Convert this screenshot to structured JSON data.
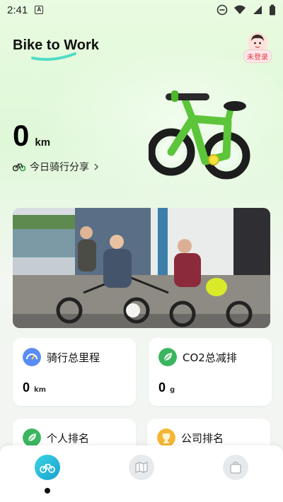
{
  "status_bar": {
    "time": "2:41",
    "badge": "A"
  },
  "header": {
    "title": "Bike to Work",
    "login_badge": "未登录"
  },
  "today": {
    "distance_value": "0",
    "distance_unit": "km",
    "share_label": "今日骑行分享"
  },
  "stats": [
    {
      "title": "骑行总里程",
      "value": "0",
      "unit": "km",
      "icon": "speedometer-icon",
      "color": "#5b8cf5"
    },
    {
      "title": "CO2总减排",
      "value": "0",
      "unit": "g",
      "icon": "leaf-icon",
      "color": "#3bb55f"
    },
    {
      "title": "个人排名",
      "icon": "leaf-icon",
      "color": "#3bb55f"
    },
    {
      "title": "公司排名",
      "icon": "trophy-icon",
      "color": "#f5b633"
    }
  ],
  "colors": {
    "accent_green": "#3bb55f",
    "nav_active": "#23b8d6"
  },
  "nav": {
    "items": [
      "bike-icon",
      "map-icon",
      "bag-icon"
    ],
    "active_index": 0
  }
}
